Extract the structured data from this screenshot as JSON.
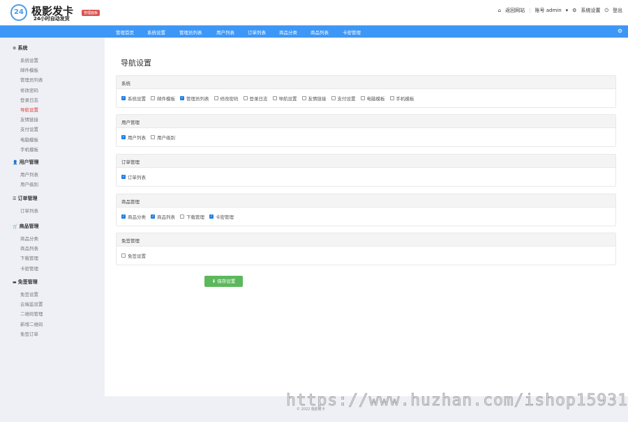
{
  "header": {
    "logo_icon": "24",
    "title": "极影发卡",
    "subtitle": "24小时自动发货",
    "badge": "管理面板",
    "links": {
      "home_icon": "home-icon",
      "back": "返回网站",
      "account": "账号 admin",
      "settings": "系统设置",
      "logout": "登出"
    }
  },
  "nav": {
    "items": [
      "管理首页",
      "系统设置",
      "管理员列表",
      "用户列表",
      "订单列表",
      "商品分类",
      "商品列表",
      "卡密管理"
    ]
  },
  "sidebar": {
    "groups": [
      {
        "title": "系统",
        "icon": "gear-icon",
        "items": [
          "系统设置",
          "邮件模板",
          "管理员列表",
          "修改密码",
          "登录日志",
          "导航设置",
          "友情链接",
          "支付设置",
          "电脑模板",
          "手机模板"
        ],
        "active": "导航设置"
      },
      {
        "title": "用户管理",
        "icon": "user-icon",
        "items": [
          "用户列表",
          "用户级别"
        ]
      },
      {
        "title": "订单管理",
        "icon": "list-icon",
        "items": [
          "订单列表"
        ]
      },
      {
        "title": "商品管理",
        "icon": "cart-icon",
        "items": [
          "商品分类",
          "商品列表",
          "下载管理",
          "卡密管理"
        ]
      },
      {
        "title": "免签管理",
        "icon": "card-icon",
        "items": [
          "免签设置",
          "云端监设置",
          "二维码管理",
          "新增二维码",
          "免签订单"
        ]
      }
    ]
  },
  "main": {
    "title": "导航设置",
    "sections": [
      {
        "title": "系统",
        "options": [
          {
            "label": "系统设置",
            "checked": true
          },
          {
            "label": "邮件模板",
            "checked": false
          },
          {
            "label": "管理员列表",
            "checked": true
          },
          {
            "label": "修改密码",
            "checked": false
          },
          {
            "label": "登录日志",
            "checked": false
          },
          {
            "label": "导航设置",
            "checked": false
          },
          {
            "label": "友情链接",
            "checked": false
          },
          {
            "label": "支付设置",
            "checked": false
          },
          {
            "label": "电脑模板",
            "checked": false
          },
          {
            "label": "手机模板",
            "checked": false
          }
        ]
      },
      {
        "title": "用户管理",
        "options": [
          {
            "label": "用户列表",
            "checked": true
          },
          {
            "label": "用户级别",
            "checked": false
          }
        ]
      },
      {
        "title": "订单管理",
        "options": [
          {
            "label": "订单列表",
            "checked": true
          }
        ]
      },
      {
        "title": "商品管理",
        "options": [
          {
            "label": "商品分类",
            "checked": true
          },
          {
            "label": "商品列表",
            "checked": true
          },
          {
            "label": "下载管理",
            "checked": false
          },
          {
            "label": "卡密管理",
            "checked": true
          }
        ]
      },
      {
        "title": "免签管理",
        "options": [
          {
            "label": "免签设置",
            "checked": false
          }
        ]
      }
    ],
    "save_label": "保存设置"
  },
  "footer": "© 2022 极影发卡",
  "watermark": "https://www.huzhan.com/ishop15931",
  "colors": {
    "nav": "#3d97f7",
    "active": "#e53935",
    "save": "#5cb85c",
    "checkbox": "#1e7be6"
  }
}
